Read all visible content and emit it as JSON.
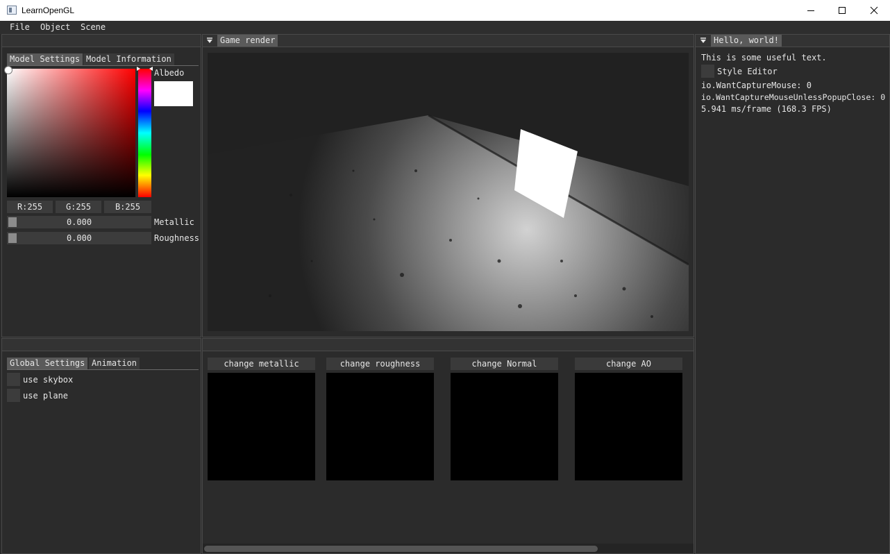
{
  "window": {
    "title": "LearnOpenGL"
  },
  "menu": {
    "items": [
      "File",
      "Object",
      "Scene"
    ]
  },
  "model_panel": {
    "tabs": [
      "Model Settings",
      "Model Information"
    ],
    "albedo_label": "Albedo",
    "albedo_color": "#ffffff",
    "rgb": {
      "r": "R:255",
      "g": "G:255",
      "b": "B:255"
    },
    "metallic": {
      "value": "0.000",
      "label": "Metallic"
    },
    "roughness": {
      "value": "0.000",
      "label": "Roughness"
    }
  },
  "global_panel": {
    "tabs": [
      "Global Settings",
      "Animation"
    ],
    "checkboxes": [
      "use skybox",
      "use plane"
    ]
  },
  "render_panel": {
    "tab": "Game render"
  },
  "texture_panel": {
    "buttons": [
      "change metallic",
      "change roughness",
      "change Normal",
      "change AO"
    ]
  },
  "hello_panel": {
    "tab": "Hello, world!",
    "text": "This is some useful text.",
    "style_editor": "Style Editor",
    "want_capture_mouse": "io.WantCaptureMouse: 0",
    "want_capture_mouse_popup": "io.WantCaptureMouseUnlessPopupClose: 0",
    "frame_stats": "5.941 ms/frame (168.3 FPS)"
  },
  "colors": {
    "panel_bg": "#2b2b2b",
    "tab_active": "#5a5a5a",
    "field_bg": "#3c3c3c",
    "accent_hue_top": "#ff0000"
  }
}
